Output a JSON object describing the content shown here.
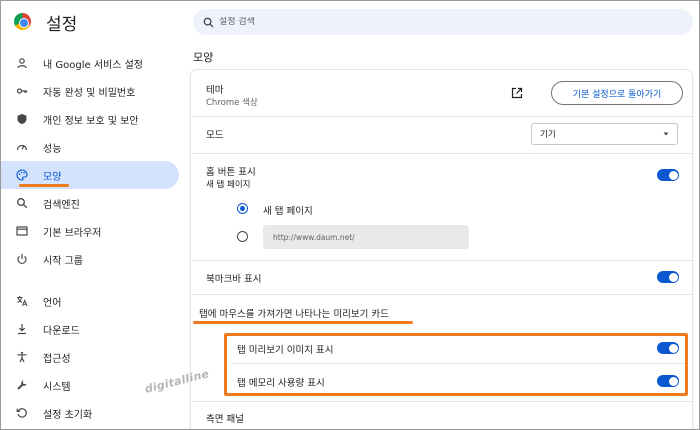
{
  "header": {
    "title": "설정",
    "search_placeholder": "설정 검색"
  },
  "sidebar": {
    "items": [
      {
        "label": "내 Google 서비스 설정",
        "icon": "person-icon"
      },
      {
        "label": "자동 완성 및 비밀번호",
        "icon": "key-icon"
      },
      {
        "label": "개인 정보 보호 및 보안",
        "icon": "shield-icon"
      },
      {
        "label": "성능",
        "icon": "speedometer-icon"
      },
      {
        "label": "모양",
        "icon": "palette-icon",
        "active": true
      },
      {
        "label": "검색엔진",
        "icon": "search-icon"
      },
      {
        "label": "기본 브라우저",
        "icon": "browser-icon"
      },
      {
        "label": "시작 그룹",
        "icon": "power-icon"
      },
      {
        "label": "언어",
        "icon": "translate-icon"
      },
      {
        "label": "다운로드",
        "icon": "download-icon"
      },
      {
        "label": "접근성",
        "icon": "accessibility-icon"
      },
      {
        "label": "시스템",
        "icon": "wrench-icon"
      },
      {
        "label": "설정 초기화",
        "icon": "restore-icon"
      }
    ]
  },
  "main": {
    "section_title": "모양",
    "theme": {
      "label": "테마",
      "value": "Chrome 색상",
      "reset_button": "기본 설정으로 돌아가기"
    },
    "mode": {
      "label": "모드",
      "selected": "기기"
    },
    "home_button": {
      "label": "홈 버튼 표시",
      "sub": "새 탭 페이지",
      "enabled": true,
      "options": {
        "new_tab": "새 탭 페이지",
        "url_value": "http://www.daum.net/"
      }
    },
    "bookmarks_bar": {
      "label": "북마크바 표시",
      "enabled": true
    },
    "hover_card": {
      "heading": "탭에 마우스를 가져가면 나타나는 미리보기 카드",
      "image_label": "탭 미리보기 이미지 표시",
      "image_enabled": true,
      "memory_label": "탭 메모리 사용량 표시",
      "memory_enabled": true
    },
    "side_panel": {
      "label": "측면 패널"
    }
  },
  "watermark": "digitalline",
  "colors": {
    "accent": "#0b57d0",
    "active_nav_bg": "#d3e3fd",
    "highlight": "#f07a21",
    "search_bg": "#eef2fa"
  }
}
